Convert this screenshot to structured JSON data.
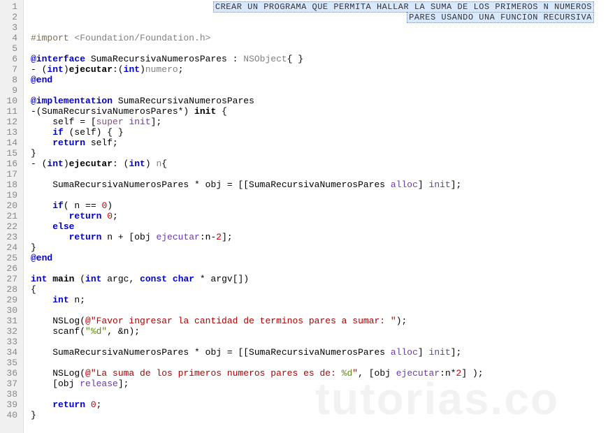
{
  "banner": {
    "line1": "CREAR UN PROGRAMA QUE PERMITA HALLAR LA SUMA DE LOS PRIMEROS N NUMEROS",
    "line2": "PARES USANDO UNA FUNCION RECURSIVA"
  },
  "watermark": "tutorias.co",
  "lines": {
    "total": 40,
    "l4_import": "#import",
    "l4_inc": "<Foundation/Foundation.h>",
    "l6_at": "@interface",
    "l6_rest": " SumaRecursivaNumerosPares : ",
    "l6_ns": "NSObject",
    "l6_brace": "{ }",
    "l7_a": "- (",
    "l7_int1": "int",
    "l7_b": ")",
    "l7_ejec": "ejecutar",
    "l7_c": ":(",
    "l7_int2": "int",
    "l7_d": ")",
    "l7_num": "numero",
    "l7_e": ";",
    "l8_end": "@end",
    "l10_impl": "@implementation",
    "l10_cls": " SumaRecursivaNumerosPares",
    "l11_a": "-(SumaRecursivaNumerosPares*) ",
    "l11_init": "init",
    "l11_b": " {",
    "l12_a": "    self = [",
    "l12_super": "super",
    "l12_b": " ",
    "l12_init": "init",
    "l12_c": "];",
    "l13_a": "    ",
    "l13_if": "if",
    "l13_b": " (self) { }",
    "l14_a": "    ",
    "l14_ret": "return",
    "l14_b": " self;",
    "l15": "}",
    "l16_a": "- (",
    "l16_int1": "int",
    "l16_b": ")",
    "l16_ejec": "ejecutar",
    "l16_c": ": (",
    "l16_int2": "int",
    "l16_d": ") ",
    "l16_n": "n",
    "l16_e": "{",
    "l18_a": "    SumaRecursivaNumerosPares * obj = [[SumaRecursivaNumerosPares ",
    "l18_alloc": "alloc",
    "l18_b": "] ",
    "l18_init": "init",
    "l18_c": "];",
    "l20_a": "    ",
    "l20_if": "if",
    "l20_b": "( n == ",
    "l20_zero": "0",
    "l20_c": ")",
    "l21_a": "       ",
    "l21_ret": "return",
    "l21_b": " ",
    "l21_zero": "0",
    "l21_c": ";",
    "l22_a": "    ",
    "l22_else": "else",
    "l23_a": "       ",
    "l23_ret": "return",
    "l23_b": " n + [obj ",
    "l23_ejec": "ejecutar",
    "l23_c": ":n-",
    "l23_two": "2",
    "l23_d": "];",
    "l24": "}",
    "l25_end": "@end",
    "l27_int": "int",
    "l27_sp": " ",
    "l27_main": "main",
    "l27_a": " (",
    "l27_int2": "int",
    "l27_b": " argc, ",
    "l27_const": "const",
    "l27_c": " ",
    "l27_char": "char",
    "l27_d": " * argv[])",
    "l28": "{",
    "l29_a": "    ",
    "l29_int": "int",
    "l29_b": " n;",
    "l31_a": "    NSLog(",
    "l31_at": "@",
    "l31_str": "\"Favor ingresar la cantidad de terminos pares a sumar: \"",
    "l31_b": ");",
    "l32_a": "    scanf(",
    "l32_fmt": "\"%d\"",
    "l32_b": ", &n);",
    "l34_a": "    SumaRecursivaNumerosPares * obj = [[SumaRecursivaNumerosPares ",
    "l34_alloc": "alloc",
    "l34_b": "] ",
    "l34_init": "init",
    "l34_c": "];",
    "l36_a": "    NSLog(",
    "l36_at": "@",
    "l36_s1": "\"La suma de los primeros numeros pares es de: ",
    "l36_fmt": "%d",
    "l36_s2": "\"",
    "l36_b": ", [obj ",
    "l36_ejec": "ejecutar",
    "l36_c": ":n*",
    "l36_two": "2",
    "l36_d": "] );",
    "l37_a": "    [obj ",
    "l37_rel": "release",
    "l37_b": "];",
    "l39_a": "    ",
    "l39_ret": "return",
    "l39_b": " ",
    "l39_zero": "0",
    "l39_c": ";",
    "l40": "}"
  }
}
